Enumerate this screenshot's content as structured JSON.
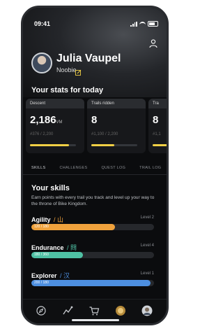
{
  "status_bar": {
    "time": "09:41"
  },
  "profile": {
    "name": "Julia Vaupel",
    "rank": "Noobie"
  },
  "stats": {
    "title": "Your stats for today",
    "cards": [
      {
        "label": "Descent",
        "value": "2,186",
        "unit": "VM",
        "sub": "#376 / 2,200",
        "progress": 0.85
      },
      {
        "label": "Trails ridden",
        "value": "8",
        "unit": "",
        "sub": "#1,100 / 2,200",
        "progress": 0.5
      },
      {
        "label": "Tra",
        "value": "8",
        "unit": "",
        "sub": "#1,1",
        "progress": 0.5
      }
    ]
  },
  "tabs": [
    "SKILLS",
    "CHALLENGES",
    "QUEST LOG",
    "TRAIL LOG"
  ],
  "active_tab": "SKILLS",
  "skills": {
    "title": "Your skills",
    "description": "Earn points with every trail you track and level up your way to the throne of Bike Kingdom.",
    "items": [
      {
        "name": "Agility",
        "glyph": "/ 山",
        "level": "Level 2",
        "bar_text": "120 / 180",
        "progress": 0.68,
        "color": "#f0a23c"
      },
      {
        "name": "Endurance",
        "glyph": "/ 閰",
        "level": "Level 4",
        "bar_text": "180 / 360",
        "progress": 0.42,
        "color": "#4fc1a4"
      },
      {
        "name": "Explorer",
        "glyph": "/ 汉",
        "level": "Level 1",
        "bar_text": "200 / 180",
        "progress": 0.97,
        "color": "#4d8fe0"
      }
    ]
  },
  "bottom_nav": [
    "compass-icon",
    "route-icon",
    "cart-icon",
    "badge-icon",
    "avatar-icon"
  ],
  "colors": {
    "accent_yellow": "#f0cf45",
    "background": "#0b0c0e"
  }
}
